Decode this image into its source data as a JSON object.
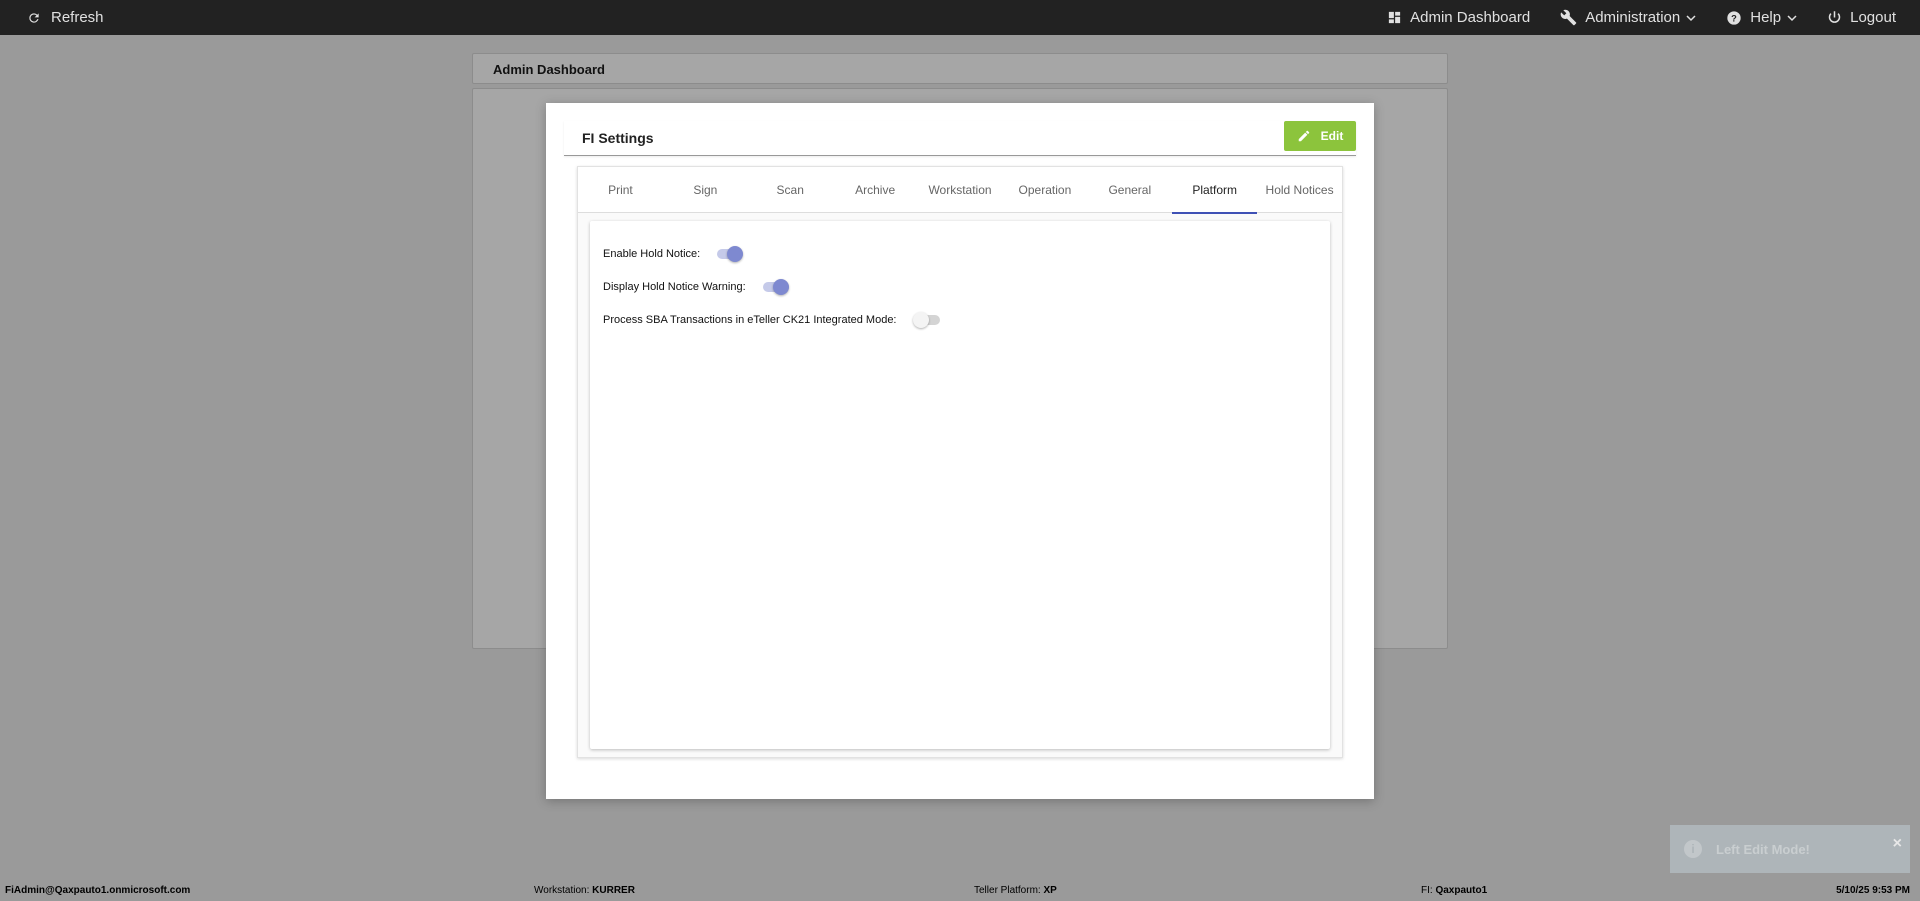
{
  "topbar": {
    "refresh_label": "Refresh",
    "admin_dashboard_label": "Admin Dashboard",
    "administration_label": "Administration",
    "help_label": "Help",
    "logout_label": "Logout"
  },
  "page": {
    "title": "Admin Dashboard"
  },
  "modal": {
    "title": "FI Settings",
    "edit_label": "Edit",
    "edit_color": "#8cc43c",
    "tabs": [
      {
        "label": "Print"
      },
      {
        "label": "Sign"
      },
      {
        "label": "Scan"
      },
      {
        "label": "Archive"
      },
      {
        "label": "Workstation"
      },
      {
        "label": "Operation"
      },
      {
        "label": "General"
      },
      {
        "label": "Platform"
      },
      {
        "label": "Hold Notices"
      }
    ],
    "active_tab": "Platform",
    "accent_color": "#3f51b5",
    "settings": [
      {
        "label": "Enable Hold Notice:",
        "enabled": true
      },
      {
        "label": "Display Hold Notice Warning:",
        "enabled": true
      },
      {
        "label": "Process SBA Transactions in eTeller CK21 Integrated Mode:",
        "enabled": false
      }
    ]
  },
  "toast": {
    "message": "Left Edit Mode!",
    "close": "×"
  },
  "footer": {
    "user": "FiAdmin@Qaxpauto1.onmicrosoft.com",
    "workstation_label": "Workstation:",
    "workstation_value": "KURRER",
    "teller_label": "Teller Platform:",
    "teller_value": "XP",
    "fi_label": "FI:",
    "fi_value": "Qaxpauto1",
    "datetime": "5/10/25 9:53 PM"
  }
}
